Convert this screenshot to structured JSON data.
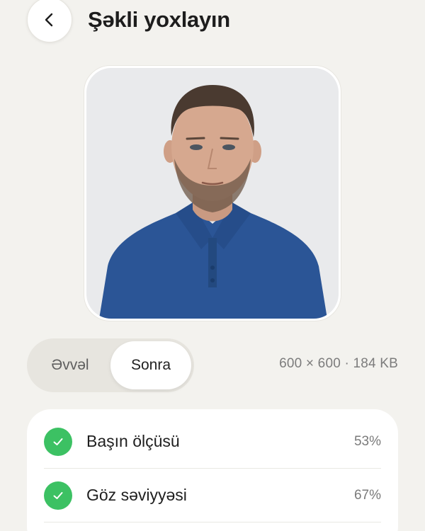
{
  "header": {
    "title": "Şəkli yoxlayın",
    "back_icon": "chevron-left-icon"
  },
  "preview": {
    "image_desc": "portrait-photo"
  },
  "compare_toggle": {
    "options": [
      "Əvvəl",
      "Sonra"
    ],
    "selected": "Sonra"
  },
  "file_info": {
    "meta": "600 × 600 · 184 KB"
  },
  "checks": [
    {
      "label": "Başın ölçüsü",
      "value": "53%",
      "status": "pass",
      "icon": "check-icon"
    },
    {
      "label": "Göz səviyyəsi",
      "value": "67%",
      "status": "pass",
      "icon": "check-icon"
    }
  ],
  "colors": {
    "background": "#f3f2ee",
    "accent_success": "#3cc163",
    "card": "#ffffff"
  }
}
